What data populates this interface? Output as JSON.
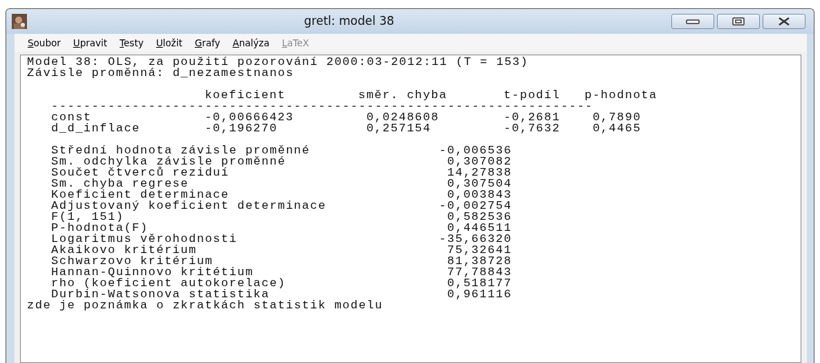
{
  "window": {
    "title": "gretl: model 38"
  },
  "menu": [
    {
      "label": "Soubor",
      "disabled": false
    },
    {
      "label": "Upravit",
      "disabled": false
    },
    {
      "label": "Testy",
      "disabled": false
    },
    {
      "label": "Uložit",
      "disabled": false
    },
    {
      "label": "Grafy",
      "disabled": false
    },
    {
      "label": "Analýza",
      "disabled": false
    },
    {
      "label": "LaTeX",
      "disabled": true
    }
  ],
  "output": {
    "header_lines": [
      "Model 38: OLS, za použití pozorování 2000:03-2012:11 (T = 153)",
      "Závisle proměnná: d_nezamestnanos"
    ],
    "coefficients": {
      "columns": [
        "koeficient",
        "směr. chyba",
        "t-podíl",
        "p-hodnota"
      ],
      "rule": "-------------------------------------------------------------------",
      "rows": [
        {
          "name": "const",
          "values": [
            "-0,00666423",
            "0,0248608",
            "-0,2681",
            "0,7890"
          ]
        },
        {
          "name": "d_d_inflace",
          "values": [
            "-0,196270",
            "0,257154",
            "-0,7632",
            "0,4465"
          ]
        }
      ]
    },
    "statistics": [
      {
        "label": "Střední hodnota závisle proměnné",
        "value": "-0,006536"
      },
      {
        "label": "Sm. odchylka závisle proměnné",
        "value": "0,307082"
      },
      {
        "label": "Součet čtverců reziduí",
        "value": "14,27838"
      },
      {
        "label": "Sm. chyba regrese",
        "value": "0,307504"
      },
      {
        "label": "Koeficient determinace",
        "value": "0,003843"
      },
      {
        "label": "Adjustovaný koeficient determinace",
        "value": "-0,002754"
      },
      {
        "label": "F(1, 151)",
        "value": "0,582536"
      },
      {
        "label": "P-hodnota(F)",
        "value": "0,446511"
      },
      {
        "label": "Logaritmus věrohodnosti",
        "value": "-35,66320"
      },
      {
        "label": "Akaikovo kritérium",
        "value": "75,32641"
      },
      {
        "label": "Schwarzovo kritérium",
        "value": "81,38728"
      },
      {
        "label": "Hannan-Quinnovo kritétium",
        "value": "77,78843"
      },
      {
        "label": "rho (koeficient autokorelace)",
        "value": "0,518177"
      },
      {
        "label": "Durbin-Watsonova statistika",
        "value": "0,961116"
      }
    ],
    "footer": "zde je poznámka o zkratkách statistik modelu"
  }
}
